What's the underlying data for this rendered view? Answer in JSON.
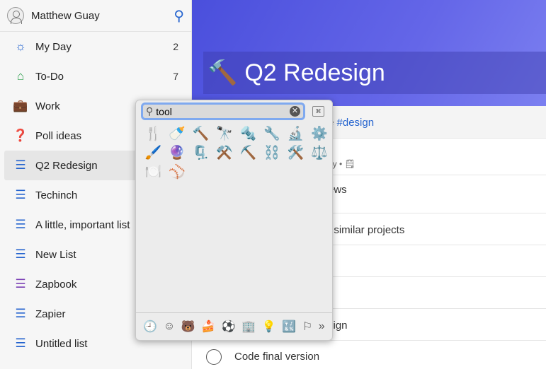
{
  "user": {
    "name": "Matthew Guay"
  },
  "sidebar": {
    "items": [
      {
        "icon": "☼",
        "label": "My Day",
        "count": "2",
        "color": "#2564cf"
      },
      {
        "icon": "⌂",
        "label": "To-Do",
        "count": "7",
        "color": "#2a9d4a"
      },
      {
        "icon": "💼",
        "label": "Work",
        "count": "",
        "color": "#8a4b20"
      },
      {
        "icon": "❓",
        "label": "Poll ideas",
        "count": "",
        "color": "#c00"
      },
      {
        "icon": "☰",
        "label": "Q2 Redesign",
        "count": "",
        "color": "#2564cf"
      },
      {
        "icon": "☰",
        "label": "Techinch",
        "count": "",
        "color": "#2564cf"
      },
      {
        "icon": "☰",
        "label": "A little, important list",
        "count": "",
        "color": "#2564cf"
      },
      {
        "icon": "☰",
        "label": "New List",
        "count": "",
        "color": "#2564cf"
      },
      {
        "icon": "☰",
        "label": "Zapbook",
        "count": "",
        "color": "#7a3fb5"
      },
      {
        "icon": "☰",
        "label": "Zapier",
        "count": "",
        "color": "#2564cf"
      },
      {
        "icon": "☰",
        "label": "Untitled list",
        "count": "",
        "color": "#2564cf"
      }
    ]
  },
  "main": {
    "title_emoji": "🔨",
    "title": "Q2 Redesign",
    "tag_prefix": "e",
    "tag": "#design",
    "rows": [
      {
        "text": "ay  •  🗒"
      },
      {
        "text": "ews"
      },
      {
        "text": "t similar projects"
      },
      {
        "text": "sign"
      },
      {
        "text": "Code final version"
      }
    ]
  },
  "picker": {
    "query": "tool",
    "emojis": [
      "🍴",
      "🍼",
      "🔨",
      "🔭",
      "🔩",
      "🔧",
      "🔬",
      "⚙️",
      "🖌️",
      "🔮",
      "🗜️",
      "⚒️",
      "⛏️",
      "⛓️",
      "🛠️",
      "⚖️",
      "🍽️",
      "⚾"
    ],
    "categories": [
      "🕘",
      "☺",
      "🐻",
      "🍰",
      "⚽",
      "🏢",
      "💡",
      "🔣",
      "⚐",
      "»"
    ]
  }
}
